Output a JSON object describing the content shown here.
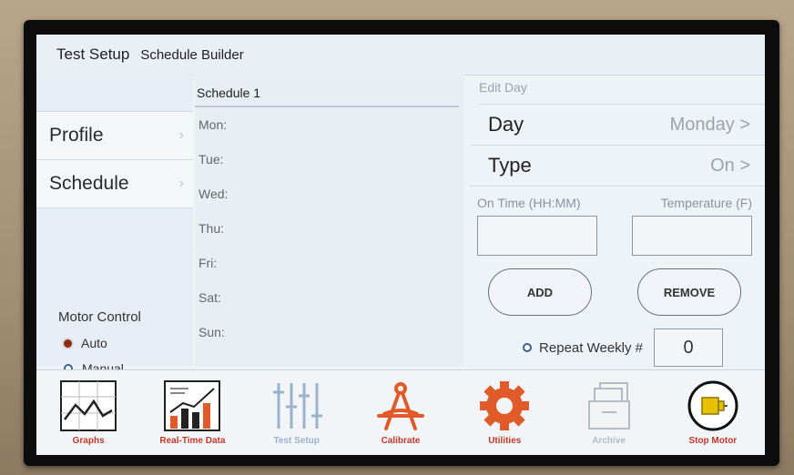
{
  "header": {
    "title": "Test Setup",
    "subtitle": "Schedule Builder"
  },
  "nav": {
    "items": [
      {
        "label": "Profile",
        "chevron": "›"
      },
      {
        "label": "Schedule",
        "chevron": "›"
      }
    ]
  },
  "motor_control": {
    "title": "Motor Control",
    "options": [
      {
        "label": "Auto",
        "selected": true
      },
      {
        "label": "Manual",
        "selected": false
      }
    ]
  },
  "schedule": {
    "title": "Schedule 1",
    "days": [
      "Mon:",
      "Tue:",
      "Wed:",
      "Thu:",
      "Fri:",
      "Sat:",
      "Sun:"
    ]
  },
  "edit_day": {
    "title": "Edit Day",
    "day_label": "Day",
    "day_value": "Monday >",
    "type_label": "Type",
    "type_value": "On >",
    "on_time_label": "On Time (HH:MM)",
    "temperature_label": "Temperature (F)",
    "add_label": "ADD",
    "remove_label": "REMOVE",
    "repeat_label": "Repeat Weekly #",
    "repeat_value": "0"
  },
  "toolbar": {
    "graphs": "Graphs",
    "realtime": "Real-Time Data",
    "test_setup": "Test Setup",
    "calibrate": "Calibrate",
    "utilities": "Utilities",
    "archive": "Archive",
    "stop_motor": "Stop Motor"
  },
  "colors": {
    "accent_red": "#c0392b",
    "orange": "#e05a2a",
    "motor_yellow": "#e8c200"
  }
}
